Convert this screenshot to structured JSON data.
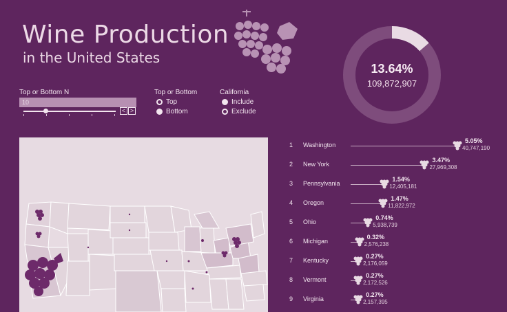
{
  "header": {
    "title": "Wine Production",
    "subtitle": "in the United States"
  },
  "summary": {
    "percent": "13.64%",
    "gallons": "109,872,907",
    "share_fraction": 0.1364
  },
  "controls": {
    "n_label": "Top or Bottom N",
    "n_value": "10",
    "decrement": "<",
    "increment": ">",
    "topbottom_label": "Top or Bottom",
    "top_option": "Top",
    "bottom_option": "Bottom",
    "topbottom_selected": "Top",
    "california_label": "California",
    "include_option": "Include",
    "exclude_option": "Exclude",
    "california_selected": "Exclude"
  },
  "ranking": [
    {
      "rank": "1",
      "state": "Washington",
      "percent": "5.05%",
      "gallons": "40,747,190",
      "share": 5.05
    },
    {
      "rank": "2",
      "state": "New York",
      "percent": "3.47%",
      "gallons": "27,969,308",
      "share": 3.47
    },
    {
      "rank": "3",
      "state": "Pennsylvania",
      "percent": "1.54%",
      "gallons": "12,405,181",
      "share": 1.54
    },
    {
      "rank": "4",
      "state": "Oregon",
      "percent": "1.47%",
      "gallons": "11,822,972",
      "share": 1.47
    },
    {
      "rank": "5",
      "state": "Ohio",
      "percent": "0.74%",
      "gallons": "5,938,739",
      "share": 0.74
    },
    {
      "rank": "6",
      "state": "Michigan",
      "percent": "0.32%",
      "gallons": "2,576,238",
      "share": 0.32
    },
    {
      "rank": "7",
      "state": "Kentucky",
      "percent": "0.27%",
      "gallons": "2,176,059",
      "share": 0.27
    },
    {
      "rank": "8",
      "state": "Vermont",
      "percent": "0.27%",
      "gallons": "2,172,526",
      "share": 0.27
    },
    {
      "rank": "9",
      "state": "Virginia",
      "percent": "0.27%",
      "gallons": "2,157,395",
      "share": 0.27
    }
  ],
  "colors": {
    "background": "#5e255e",
    "accent": "#e9dbe4",
    "ring": "#7e4c7c",
    "map_bg": "#e7dbe2",
    "grape": "#6d2a6a"
  }
}
